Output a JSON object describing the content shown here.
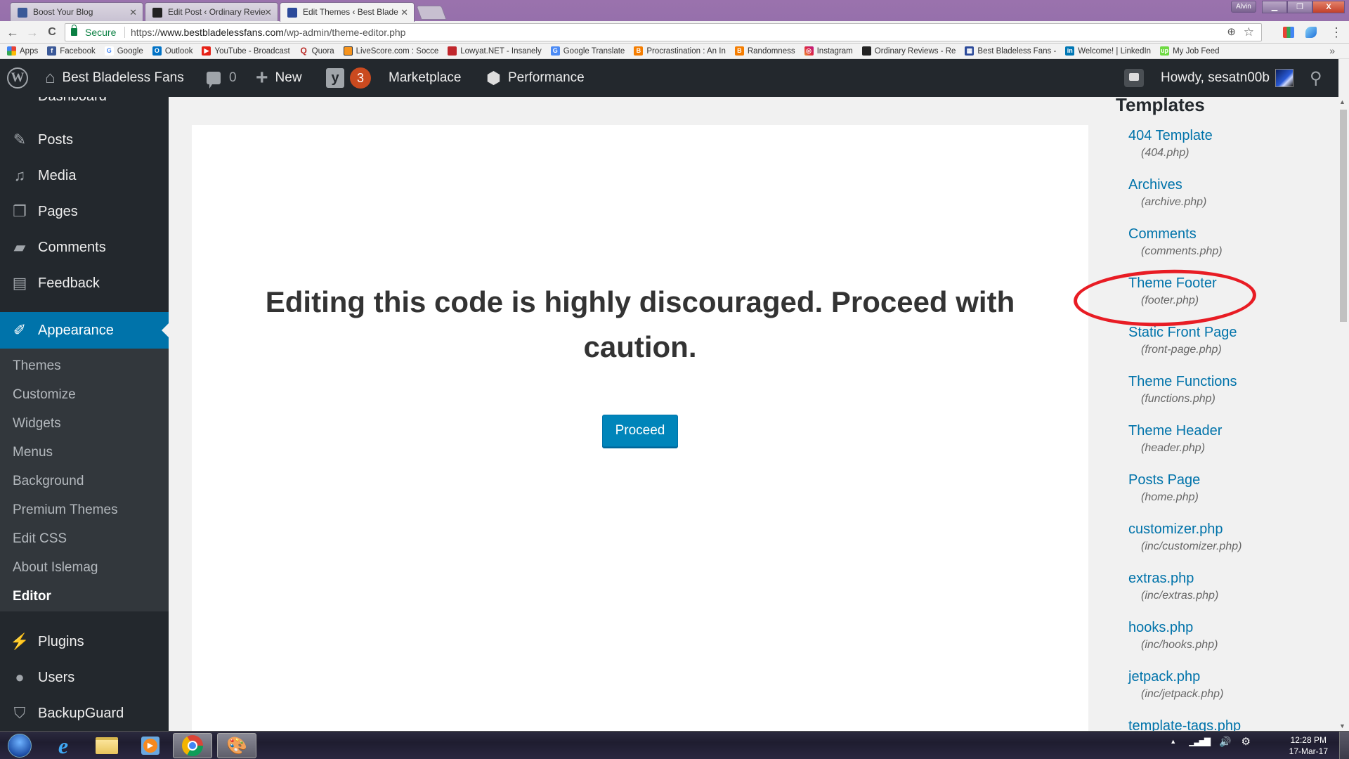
{
  "browser": {
    "tabs": [
      {
        "title": "Boost Your Blog",
        "icon": "facebook-icon",
        "active": false
      },
      {
        "title": "Edit Post ‹ Ordinary Revie",
        "icon": "ordinary-reviews-icon",
        "active": false
      },
      {
        "title": "Edit Themes ‹ Best Blade",
        "icon": "site-grid-icon",
        "active": true
      }
    ],
    "close_glyph": "✕",
    "window_user": "Alvin",
    "window_buttons": {
      "minimize": "▁",
      "restore": "❐",
      "close": "X"
    },
    "nav": {
      "back": "←",
      "forward": "→",
      "reload": "C"
    },
    "omnibox": {
      "secure_label": "Secure",
      "url_scheme": "https://",
      "url_host": "www.bestbladelessfans.com",
      "url_path": "/wp-admin/theme-editor.php"
    },
    "omnibox_icons": {
      "zoom": "⊕",
      "star": "☆"
    },
    "menu_glyph": "⋮",
    "bookmarks": [
      {
        "label": "Apps",
        "icon": "apps-grid-icon",
        "color": "#e94235"
      },
      {
        "label": "Facebook",
        "icon": "facebook-icon",
        "color": "#3b5998"
      },
      {
        "label": "Google",
        "icon": "google-icon",
        "color": "#4285f4"
      },
      {
        "label": "Outlook",
        "icon": "outlook-icon",
        "color": "#0072c6"
      },
      {
        "label": "YouTube - Broadcast",
        "icon": "youtube-icon",
        "color": "#e62117"
      },
      {
        "label": "Quora",
        "icon": "quora-icon",
        "color": "#b92b27"
      },
      {
        "label": "LiveScore.com : Socce",
        "icon": "livescore-icon",
        "color": "#f7941d"
      },
      {
        "label": "Lowyat.NET - Insanely",
        "icon": "lowyat-icon",
        "color": "#c1272d"
      },
      {
        "label": "Google Translate",
        "icon": "google-translate-icon",
        "color": "#4c8bf5"
      },
      {
        "label": "Procrastination : An In",
        "icon": "blogger-icon",
        "color": "#f57d00"
      },
      {
        "label": "Randomness",
        "icon": "blogger-icon",
        "color": "#f57d00"
      },
      {
        "label": "Instagram",
        "icon": "instagram-icon",
        "color": "#c13584"
      },
      {
        "label": "Ordinary Reviews - Re",
        "icon": "ordinary-reviews-icon",
        "color": "#222222"
      },
      {
        "label": "Best Bladeless Fans -",
        "icon": "site-grid-icon",
        "color": "#2c4a9a"
      },
      {
        "label": "Welcome! | LinkedIn",
        "icon": "linkedin-icon",
        "color": "#0077b5"
      },
      {
        "label": "My Job Feed",
        "icon": "upwork-icon",
        "color": "#6fda44"
      }
    ],
    "bookmarks_more": "»"
  },
  "adminbar": {
    "wp_logo": "W",
    "site_name": "Best Bladeless Fans",
    "comments_count": "0",
    "new_label": "New",
    "yoast_letter": "y",
    "yoast_count": "3",
    "marketplace_label": "Marketplace",
    "performance_label": "Performance",
    "howdy": "Howdy, sesatn00b",
    "search_glyph": "🔍"
  },
  "sidebar": {
    "peek_label": "Dashboard",
    "items": [
      {
        "label": "Posts",
        "icon": "pushpin-icon",
        "glyph": "📌"
      },
      {
        "label": "Media",
        "icon": "media-icon",
        "glyph": "🎵"
      },
      {
        "label": "Pages",
        "icon": "pages-icon",
        "glyph": "❐"
      },
      {
        "label": "Comments",
        "icon": "comment-icon",
        "glyph": "💬"
      },
      {
        "label": "Feedback",
        "icon": "feedback-icon",
        "glyph": "▤"
      },
      {
        "label": "Appearance",
        "icon": "paintbrush-icon",
        "glyph": "🖌",
        "current": true
      },
      {
        "label": "Plugins",
        "icon": "plug-icon",
        "glyph": "🔌"
      },
      {
        "label": "Users",
        "icon": "user-icon",
        "glyph": "👤"
      },
      {
        "label": "BackupGuard",
        "icon": "shield-icon",
        "glyph": "🛡"
      }
    ],
    "appearance_submenu": [
      {
        "label": "Themes"
      },
      {
        "label": "Customize"
      },
      {
        "label": "Widgets"
      },
      {
        "label": "Menus"
      },
      {
        "label": "Background"
      },
      {
        "label": "Premium Themes"
      },
      {
        "label": "Edit CSS"
      },
      {
        "label": "About Islemag"
      },
      {
        "label": "Editor",
        "current": true
      }
    ]
  },
  "main": {
    "warning_text": "Editing this code is highly discouraged. Proceed with caution.",
    "proceed_label": "Proceed"
  },
  "templates": {
    "heading": "Templates",
    "items": [
      {
        "name": "404 Template",
        "file": "(404.php)"
      },
      {
        "name": "Archives",
        "file": "(archive.php)"
      },
      {
        "name": "Comments",
        "file": "(comments.php)"
      },
      {
        "name": "Theme Footer",
        "file": "(footer.php)",
        "annotated": true
      },
      {
        "name": "Static Front Page",
        "file": "(front-page.php)"
      },
      {
        "name": "Theme Functions",
        "file": "(functions.php)"
      },
      {
        "name": "Theme Header",
        "file": "(header.php)"
      },
      {
        "name": "Posts Page",
        "file": "(home.php)"
      },
      {
        "name": "customizer.php",
        "file": "(inc/customizer.php)"
      },
      {
        "name": "extras.php",
        "file": "(inc/extras.php)"
      },
      {
        "name": "hooks.php",
        "file": "(inc/hooks.php)"
      },
      {
        "name": "jetpack.php",
        "file": "(inc/jetpack.php)"
      },
      {
        "name": "template-tags.php",
        "file": ""
      }
    ],
    "annotation_color": "#e81c24"
  },
  "colors": {
    "wp_accent": "#0073aa",
    "button_blue": "#0085ba",
    "adminbar_bg": "#23282d",
    "submenu_bg": "#32373c",
    "link_blue": "#0073aa"
  },
  "taskbar": {
    "apps": [
      {
        "name": "start-button"
      },
      {
        "name": "internet-explorer-icon",
        "glyph": "e"
      },
      {
        "name": "file-explorer-icon",
        "glyph": "📁"
      },
      {
        "name": "media-player-icon",
        "glyph": "▶"
      },
      {
        "name": "chrome-icon",
        "active": true
      },
      {
        "name": "paint-icon",
        "glyph": "🎨",
        "active": true
      }
    ],
    "tray_glyphs": {
      "show_hidden": "▲",
      "signal": "📶",
      "volume": "🔊",
      "sync": "⚙"
    },
    "time": "12:28 PM",
    "date": "17-Mar-17"
  }
}
